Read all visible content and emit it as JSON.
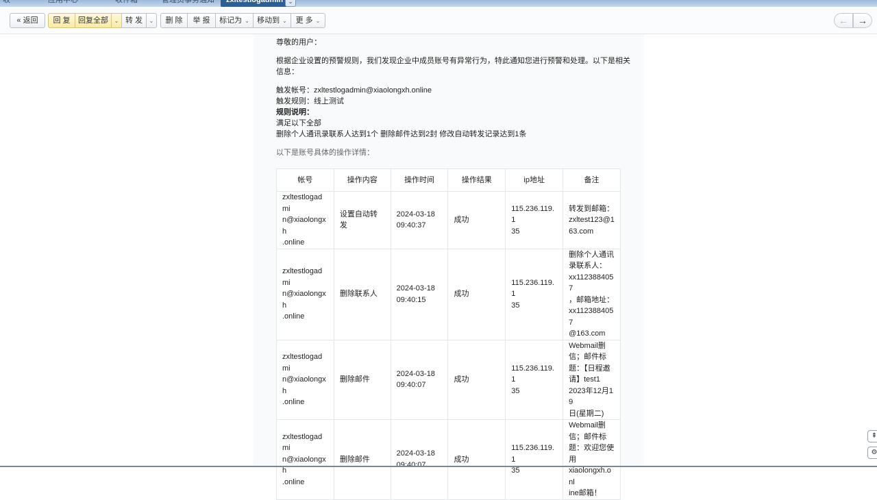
{
  "tabs": [
    {
      "label": "收",
      "active": false
    },
    {
      "label": "应用中心",
      "active": false
    },
    {
      "label": "收件箱",
      "active": false
    },
    {
      "label": "管理员事务通知",
      "active": false
    },
    {
      "label": "zxltestlogadmin",
      "active": true
    }
  ],
  "toolbar": {
    "back": "« 返回",
    "reply": "回 复",
    "reply_all": "回复全部",
    "forward": "转 发",
    "delete": "删 除",
    "report": "举 报",
    "mark_as": "标记为",
    "move_to": "移动到",
    "more": "更 多",
    "prev_icon": "←",
    "next_icon": "→"
  },
  "mail": {
    "greeting": "尊敬的用户：",
    "intro_line1": "根据企业设置的预警规则，我们发现企业中成员账号有异常行为，特此通知您进行预警和处理。以下是相关",
    "intro_line2": "信息：",
    "trigger_account": "触发帐号：zxltestlogadmin@xiaolongxh.online",
    "trigger_rule": "触发规则：线上测试",
    "rule_desc_label": "规则说明：",
    "rule_satisfy": "满足以下全部",
    "rule_conditions": "删除个人通讯录联系人达到1个 删除邮件达到2封 修改自动转发记录达到1条",
    "details_title": "以下是账号具体的操作详情："
  },
  "table": {
    "headers": [
      "帐号",
      "操作内容",
      "操作时间",
      "操作结果",
      "ip地址",
      "备注"
    ],
    "rows": [
      {
        "account": "zxltestlogadmi\nn@xiaolongxh\n.online",
        "action": "设置自动转发",
        "time": "2024-03-18\n09:40:37",
        "result": "成功",
        "ip": "115.236.119.1\n35",
        "note": "转发到邮箱：\nzxltest123@1\n63.com"
      },
      {
        "account": "zxltestlogadmi\nn@xiaolongxh\n.online",
        "action": "删除联系人",
        "time": "2024-03-18\n09:40:15",
        "result": "成功",
        "ip": "115.236.119.1\n35",
        "note": "删除个人通讯\n录联系人：\nxx1123884057\n，邮箱地址：\nxx1123884057\n@163.com"
      },
      {
        "account": "zxltestlogadmi\nn@xiaolongxh\n.online",
        "action": "删除邮件",
        "time": "2024-03-18\n09:40:07",
        "result": "成功",
        "ip": "115.236.119.1\n35",
        "note": "Webmail删\n信；邮件标\n题：【日程邀\n请】test1\n2023年12月19\n日(星期二)"
      },
      {
        "account": "zxltestlogadmi\nn@xiaolongxh\n.online",
        "action": "删除邮件",
        "time": "2024-03-18\n09:40:07",
        "result": "成功",
        "ip": "115.236.119.1\n35",
        "note": "Webmail删\n信；邮件标\n题：欢迎您使\n用\nxiaolongxh.onl\nine邮箱！"
      }
    ]
  },
  "side_buttons": {
    "top_icon": "⇞",
    "gear_icon": "⚙"
  }
}
